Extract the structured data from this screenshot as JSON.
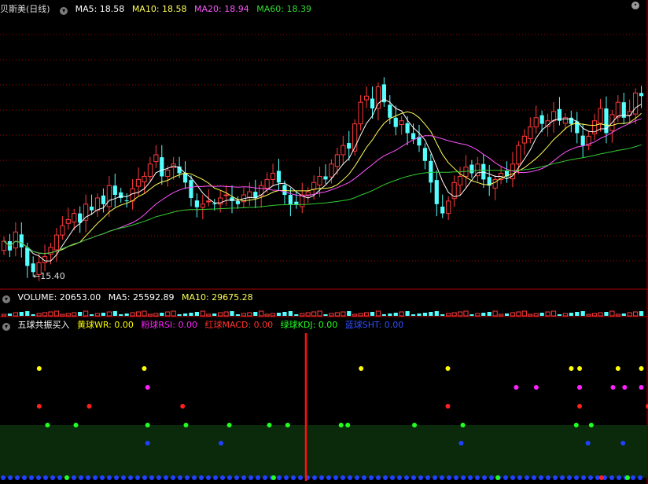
{
  "price_header": {
    "title": "贝斯美(日线)",
    "ma5": "MA5: 18.58",
    "ma10": "MA10: 18.58",
    "ma20": "MA20: 18.94",
    "ma60": "MA60: 18.39"
  },
  "volume_header": {
    "volume": "VOLUME: 20653.00",
    "ma5": "MA5: 25592.89",
    "ma10": "MA10: 29675.28"
  },
  "indicator_header": {
    "title": "五球共振买入",
    "yellow": "黄球WR: 0.00",
    "pink": "粉球RSI: 0.00",
    "red": "红球MACD: 0.00",
    "green": "绿球KDJ: 0.00",
    "blue": "蓝球SHT: 0.00"
  },
  "low_marker": "←15.40",
  "colors": {
    "up": "#ff3b3b",
    "down": "#54ffff",
    "ma5": "#ffffff",
    "ma10": "#ffff55",
    "ma20": "#ff55ff",
    "ma60": "#33cc33",
    "grid": "#aa0000",
    "yellow_ball": "#ffff00",
    "pink_ball": "#ff22ff",
    "red_ball": "#ff2020",
    "green_ball": "#22ff22",
    "blue_ball": "#2040ff",
    "cursor": "#ff1010"
  },
  "chart_data": {
    "type": "candlestick",
    "low_label": 15.4,
    "close": [
      16.4,
      16.1,
      16.7,
      16.2,
      15.6,
      15.4,
      15.7,
      15.9,
      16.2,
      16.6,
      16.9,
      17.1,
      17.3,
      17.0,
      17.6,
      17.4,
      17.8,
      17.6,
      18.2,
      17.9,
      17.8,
      17.7,
      18.1,
      18.4,
      18.5,
      18.9,
      19.2,
      18.5,
      18.7,
      18.9,
      18.6,
      18.3,
      17.8,
      17.5,
      17.6,
      17.7,
      17.6,
      17.8,
      17.9,
      17.7,
      17.6,
      17.9,
      18.0,
      17.8,
      18.2,
      18.4,
      18.6,
      18.3,
      17.9,
      17.6,
      17.6,
      17.9,
      18.0,
      18.3,
      18.5,
      18.4,
      18.9,
      19.2,
      19.5,
      19.4,
      20.2,
      20.9,
      21.1,
      20.7,
      21.4,
      20.9,
      20.4,
      20.1,
      20.3,
      19.9,
      19.7,
      19.5,
      19.0,
      18.3,
      17.6,
      17.3,
      17.7,
      18.3,
      18.5,
      18.8,
      18.6,
      18.9,
      18.4,
      18.2,
      18.4,
      18.6,
      18.5,
      18.9,
      19.5,
      19.8,
      20.1,
      20.4,
      20.2,
      20.3,
      20.6,
      20.3,
      20.4,
      20.2,
      19.9,
      19.5,
      19.8,
      20.3,
      20.7,
      19.9,
      20.5,
      20.9,
      20.4,
      20.6,
      21.2,
      21.1
    ]
  },
  "indicator_signals": {
    "yellow": [
      15,
      78,
      208,
      260,
      334,
      339,
      362,
      376
    ],
    "pink": [
      80,
      301,
      313,
      339,
      339,
      359,
      366,
      376
    ],
    "red": [
      15,
      45,
      101,
      260,
      339,
      380
    ],
    "green": [
      20,
      37,
      80,
      103,
      129,
      153,
      164,
      196,
      200,
      240,
      269,
      337,
      346
    ],
    "blue": [
      80,
      124,
      268,
      344,
      365
    ]
  }
}
